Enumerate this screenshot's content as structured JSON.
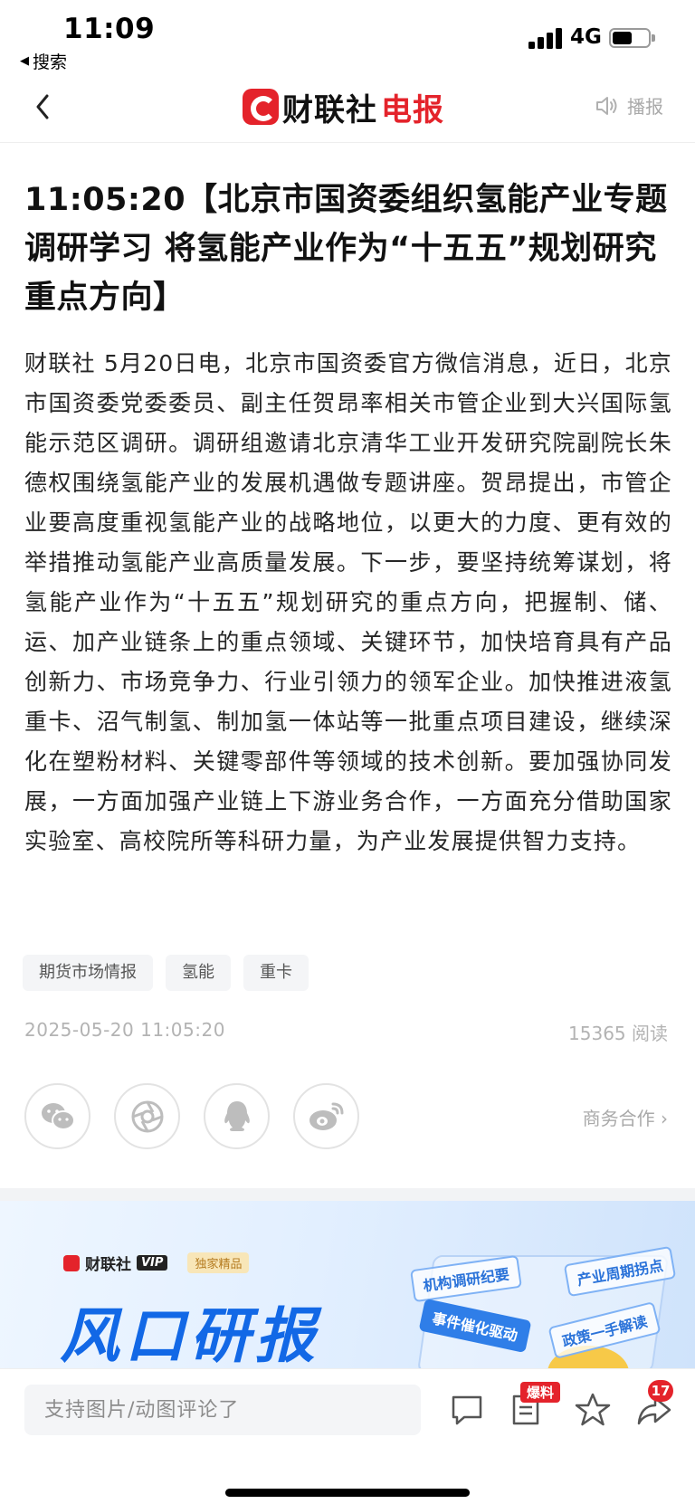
{
  "status_bar": {
    "time": "11:09",
    "back_app": "搜索",
    "network": "4G",
    "battery_level": 0.55
  },
  "nav": {
    "brand_name": "财联社",
    "brand_suffix": "电报",
    "broadcast_label": "播报"
  },
  "article": {
    "headline": "11:05:20【北京市国资委组织氢能产业专题调研学习  将氢能产业作为“十五五”规划研究重点方向】",
    "body": "财联社 5月20日电，北京市国资委官方微信消息，近日，北京市国资委党委委员、副主任贺昂率相关市管企业到大兴国际氢能示范区调研。调研组邀请北京清华工业开发研究院副院长朱德权围绕氢能产业的发展机遇做专题讲座。贺昂提出，市管企业要高度重视氢能产业的战略地位，以更大的力度、更有效的举措推动氢能产业高质量发展。下一步，要坚持统筹谋划，将氢能产业作为“十五五”规划研究的重点方向，把握制、储、运、加产业链条上的重点领域、关键环节，加快培育具有产品创新力、市场竞争力、行业引领力的领军企业。加快推进液氢重卡、沼气制氢、制加氢一体站等一批重点项目建设，继续深化在塑粉材料、关键零部件等领域的技术创新。要加强协同发展，一方面加强产业链上下游业务合作，一方面充分借助国家实验室、高校院所等科研力量，为产业发展提供智力支持。",
    "tags": [
      "期货市场情报",
      "氢能",
      "重卡"
    ],
    "date": "2025-05-20 11:05:20",
    "read_count": "15365 阅读",
    "business_link": "商务合作 ›"
  },
  "share": {
    "icons": [
      "wechat-icon",
      "moments-icon",
      "qq-icon",
      "weibo-icon"
    ]
  },
  "banner": {
    "brand": "财联社",
    "vip": "VIP",
    "exclusive": "独家精品",
    "title": "风口研报",
    "chips": [
      "机构调研纪要",
      "产业周期拐点",
      "事件催化驱动",
      "政策一手解读"
    ]
  },
  "bottom_bar": {
    "comment_placeholder": "支持图片/动图评论了",
    "news_badge": "爆料",
    "share_count": "17"
  },
  "colors": {
    "brand_red": "#e4232b",
    "banner_blue": "#1268e6",
    "muted_gray": "#b3b3b3"
  }
}
